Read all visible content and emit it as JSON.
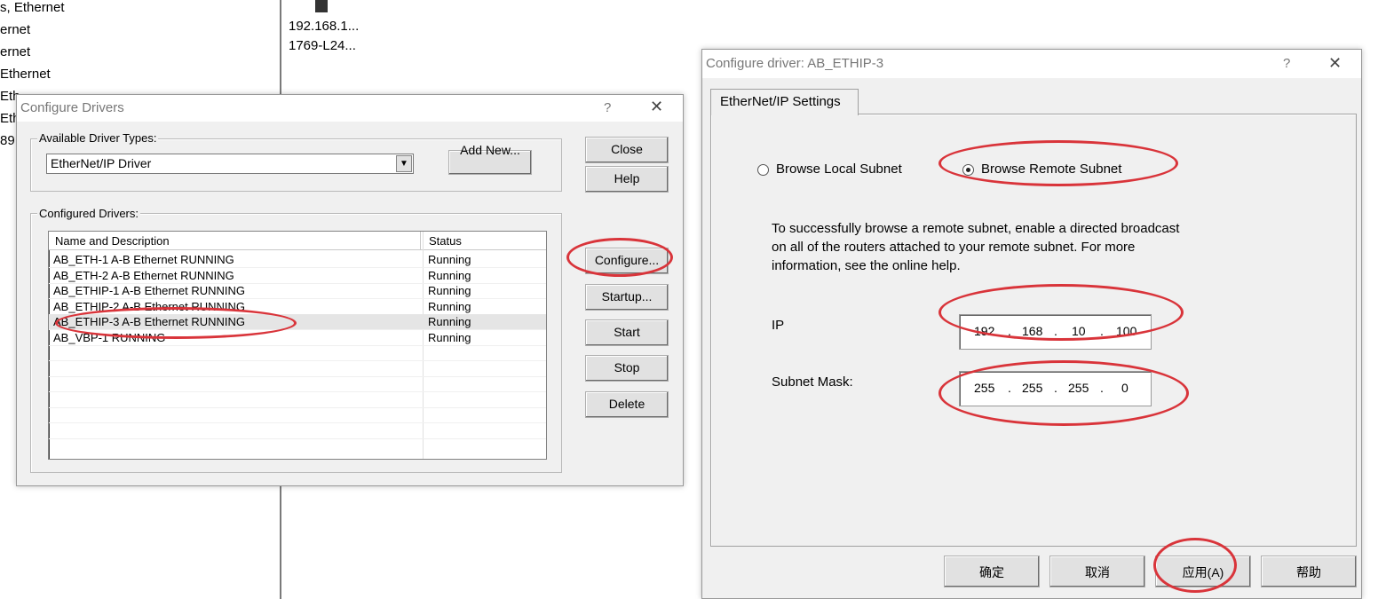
{
  "tree": {
    "items": [
      "s, Ethernet",
      "ernet",
      "ernet",
      "Ethernet",
      "Eth",
      "Eth",
      "89"
    ]
  },
  "network": {
    "node_ip": "192.168.1...",
    "node_model": "1769-L24..."
  },
  "configure_drivers": {
    "title": "Configure Drivers",
    "help_mark": "?",
    "available_label": "Available Driver Types:",
    "driver_type_value": "EtherNet/IP Driver",
    "add_new": "Add New...",
    "configured_label": "Configured Drivers:",
    "columns": [
      "Name and Description",
      "Status"
    ],
    "rows": [
      {
        "name": "AB_ETH-1  A-B Ethernet  RUNNING",
        "status": "Running"
      },
      {
        "name": "AB_ETH-2  A-B Ethernet  RUNNING",
        "status": "Running"
      },
      {
        "name": "AB_ETHIP-1  A-B Ethernet  RUNNING",
        "status": "Running"
      },
      {
        "name": "AB_ETHIP-2  A-B Ethernet  RUNNING",
        "status": "Running"
      },
      {
        "name": "AB_ETHIP-3  A-B Ethernet  RUNNING",
        "status": "Running"
      },
      {
        "name": "AB_VBP-1          RUNNING",
        "status": "Running"
      }
    ],
    "buttons": {
      "close": "Close",
      "help": "Help",
      "configure": "Configure...",
      "startup": "Startup...",
      "start": "Start",
      "stop": "Stop",
      "delete": "Delete"
    }
  },
  "configure_driver": {
    "title": "Configure driver: AB_ETHIP-3",
    "help_mark": "?",
    "tab": "EtherNet/IP Settings",
    "radio_local": "Browse Local Subnet",
    "radio_remote": "Browse Remote Subnet",
    "info_line1": "To successfully browse a remote subnet, enable a directed broadcast",
    "info_line2": "on all of the routers attached to your remote subnet. For more",
    "info_line3": "information, see the online help.",
    "ip_label": "IP",
    "ip": [
      "192",
      "168",
      "10",
      "100"
    ],
    "mask_label": "Subnet Mask:",
    "mask": [
      "255",
      "255",
      "255",
      "0"
    ],
    "dot": ".",
    "buttons": {
      "ok": "确定",
      "cancel": "取消",
      "apply": "应用(A)",
      "help": "帮助"
    }
  },
  "colors": {
    "annotation": "#d9343a",
    "dialog_bg": "#f0f0f0"
  }
}
